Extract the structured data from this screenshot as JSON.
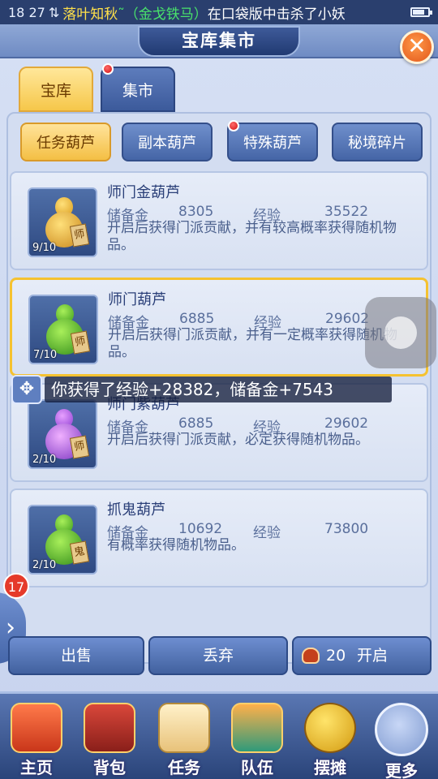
{
  "statusbar": {
    "time": "18 27",
    "marquee_name": "落叶知秋",
    "marquee_mount": "˜（金戈铁马）",
    "marquee_rest": "在口袋版中击杀了小妖"
  },
  "header": {
    "title": "宝库集市",
    "close_label": "✕"
  },
  "tabs": [
    {
      "label": "宝库"
    },
    {
      "label": "集市"
    }
  ],
  "subtabs": [
    {
      "label": "任务葫芦"
    },
    {
      "label": "副本葫芦"
    },
    {
      "label": "特殊葫芦"
    },
    {
      "label": "秘境碎片"
    }
  ],
  "items": [
    {
      "name": "师门金葫芦",
      "count": "9/10",
      "tag": "师",
      "label_money": "储备金",
      "money": "8305",
      "label_exp": "经验",
      "exp": "35522",
      "desc": "开启后获得门派贡献，并有较高概率获得随机物品。"
    },
    {
      "name": "师门葫芦",
      "count": "7/10",
      "tag": "师",
      "label_money": "储备金",
      "money": "6885",
      "label_exp": "经验",
      "exp": "29602",
      "desc": "开启后获得门派贡献，并有一定概率获得随机物品。"
    },
    {
      "name": "师门紫葫芦",
      "count": "2/10",
      "tag": "师",
      "label_money": "储备金",
      "money": "6885",
      "label_exp": "经验",
      "exp": "29602",
      "desc": "开启后获得门派贡献，必定获得随机物品。"
    },
    {
      "name": "抓鬼葫芦",
      "count": "2/10",
      "tag": "鬼",
      "label_money": "储备金",
      "money": "10692",
      "label_exp": "经验",
      "exp": "73800",
      "desc": "有概率获得随机物品。"
    }
  ],
  "toast": "你获得了经验+28382，储备金+7543",
  "side_badge": "17",
  "actions": {
    "sell": "出售",
    "drop": "丢弃",
    "open_count": "20",
    "open": "开启"
  },
  "nav": [
    {
      "label": "主页"
    },
    {
      "label": "背包"
    },
    {
      "label": "任务"
    },
    {
      "label": "队伍"
    },
    {
      "label": "摆摊"
    },
    {
      "label": "更多"
    }
  ],
  "colors": {
    "accent_gold": "#f6c74a",
    "primary_blue": "#4565a6",
    "close_orange": "#e2561a"
  }
}
